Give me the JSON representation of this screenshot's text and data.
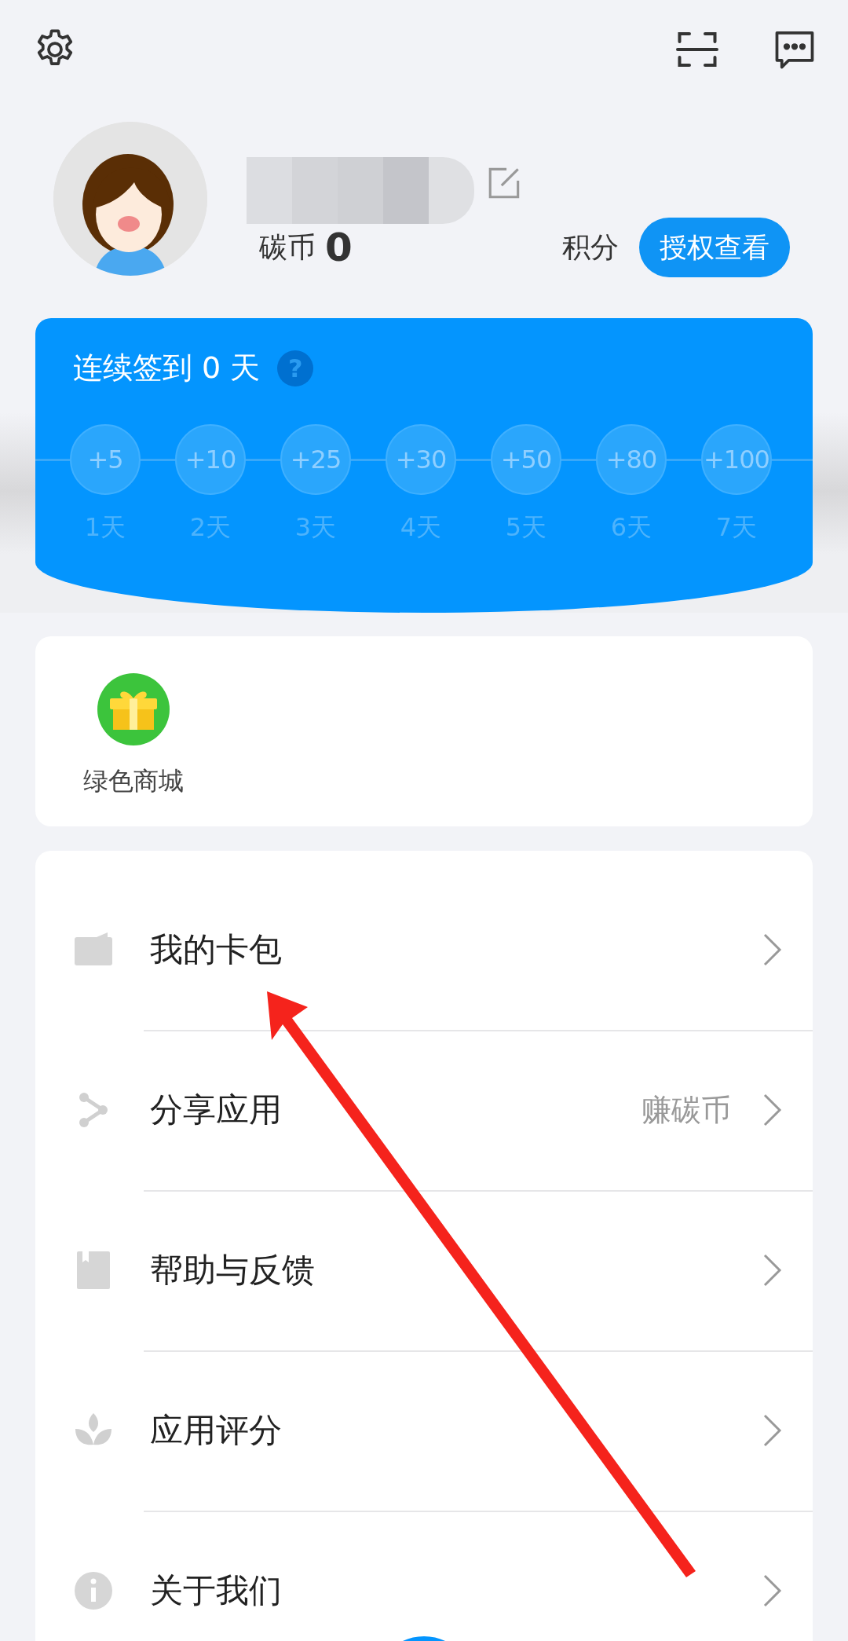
{
  "profile": {
    "coin_label": "碳币",
    "coin_value": "0",
    "points_label": "积分",
    "auth_button": "授权查看"
  },
  "checkin": {
    "title": "连续签到 0 天",
    "help": "?",
    "days": [
      {
        "reward": "+5",
        "day": "1天",
        "checked": false
      },
      {
        "reward": "+10",
        "day": "2天",
        "checked": false
      },
      {
        "reward": "+25",
        "day": "3天",
        "checked": false
      },
      {
        "reward": "+30",
        "day": "4天",
        "checked": false
      },
      {
        "reward": "+50",
        "day": "5天",
        "checked": false
      },
      {
        "reward": "+80",
        "day": "6天",
        "checked": false
      },
      {
        "reward": "+100",
        "day": "7天",
        "checked": false
      }
    ]
  },
  "shortcuts": [
    {
      "label": "绿色商城"
    }
  ],
  "menu": [
    {
      "label": "我的卡包"
    },
    {
      "label": "分享应用",
      "note": "赚碳币"
    },
    {
      "label": "帮助与反馈"
    },
    {
      "label": "应用评分"
    },
    {
      "label": "关于我们"
    }
  ]
}
